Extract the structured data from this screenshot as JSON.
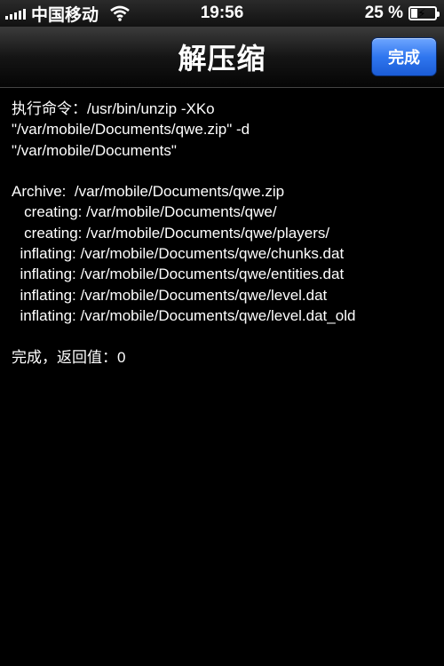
{
  "status_bar": {
    "carrier": "中国移动",
    "time": "19:56",
    "battery_percent": "25 %",
    "battery_level": 0.25,
    "signal_icon": "signal-bars-icon",
    "wifi_icon": "wifi-icon",
    "battery_icon": "battery-charging-icon"
  },
  "nav": {
    "title": "解压缩",
    "done_label": "完成",
    "done_color": "#2f76ef"
  },
  "log": {
    "lines": [
      "执行命令：/usr/bin/unzip -XKo",
      "\"/var/mobile/Documents/qwe.zip\" -d",
      "\"/var/mobile/Documents\"",
      "",
      "Archive:  /var/mobile/Documents/qwe.zip",
      "   creating: /var/mobile/Documents/qwe/",
      "   creating: /var/mobile/Documents/qwe/players/",
      "  inflating: /var/mobile/Documents/qwe/chunks.dat",
      "  inflating: /var/mobile/Documents/qwe/entities.dat",
      "  inflating: /var/mobile/Documents/qwe/level.dat",
      "  inflating: /var/mobile/Documents/qwe/level.dat_old",
      "",
      "完成，返回值：0"
    ]
  }
}
